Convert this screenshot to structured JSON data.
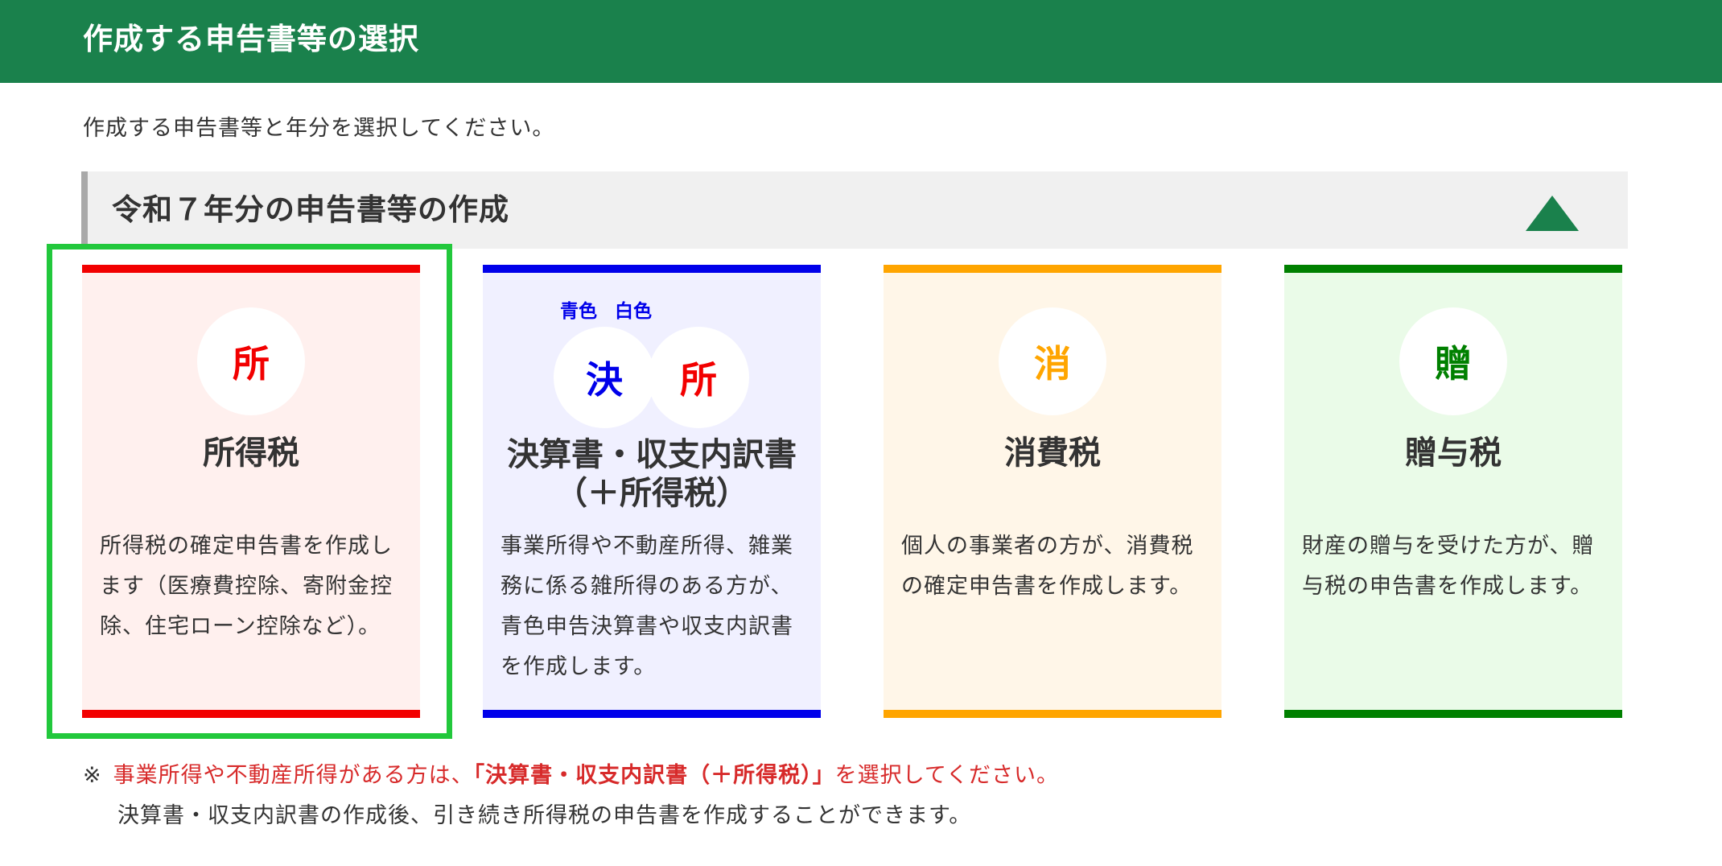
{
  "header": {
    "title": "作成する申告書等の選択"
  },
  "instruction": "作成する申告書等と年分を選択してください。",
  "section": {
    "title": "令和７年分の申告書等の作成",
    "collapse_icon": "triangle-up-icon",
    "accent_color": "#1a814c"
  },
  "cards": [
    {
      "icon_char": "所",
      "title": "所得税",
      "desc": [
        "所得税の確定申告書を作成し",
        "ます（医療費控除、寄附金控",
        "除、住宅ローン控除など）。"
      ],
      "accent_color": "#f20000",
      "bg_color": "#fff0ee",
      "selected": true
    },
    {
      "labels": [
        "青色",
        "白色"
      ],
      "icon_chars": [
        "決",
        "所"
      ],
      "title_lines": [
        "決算書・収支内訳書",
        "（＋所得税）"
      ],
      "desc": [
        "事業所得や不動産所得、雑業",
        "務に係る雑所得のある方が、",
        "青色申告決算書や収支内訳書",
        "を作成します。"
      ],
      "accent_color": "#0000ea",
      "label_color": "#0000ea",
      "bg_color": "#f0f0ff"
    },
    {
      "icon_char": "消",
      "title": "消費税",
      "desc": [
        "個人の事業者の方が、消費税",
        "の確定申告書を作成します。"
      ],
      "accent_color": "#ffa500",
      "bg_color": "#fff6e8"
    },
    {
      "icon_char": "贈",
      "title": "贈与税",
      "desc": [
        "財産の贈与を受けた方が、贈",
        "与税の申告書を作成します。"
      ],
      "accent_color": "#008000",
      "bg_color": "#eafbe8"
    }
  ],
  "note": {
    "mark": "※",
    "part1": "事業所得や不動産所得がある方は、",
    "part2": "「決算書・収支内訳書（＋所得税）」",
    "part3": "を選択してください。",
    "line2": "決算書・収支内訳書の作成後、引き続き所得税の申告書を作成することができます。"
  },
  "colors": {
    "header_bg": "#1a814c",
    "selection_frame": "#22c83c",
    "note_red": "#d72a2a"
  }
}
